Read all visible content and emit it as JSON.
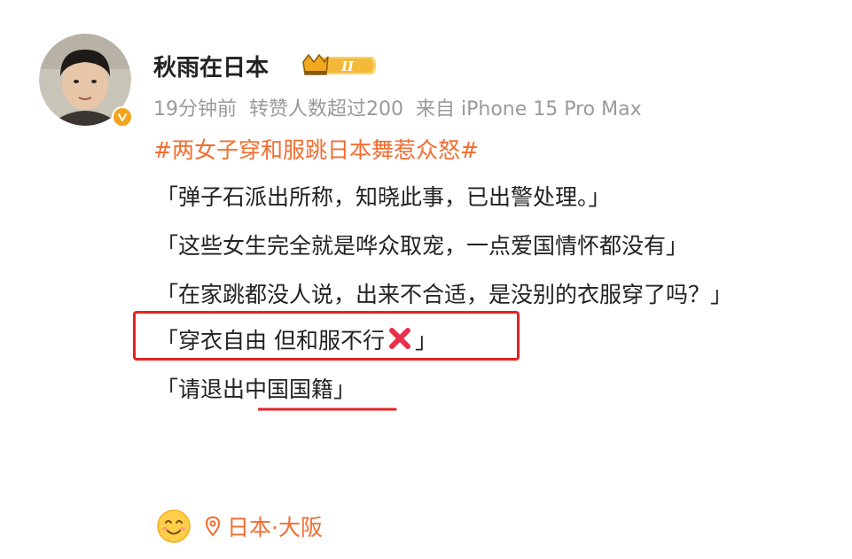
{
  "post": {
    "username": "秋雨在日本",
    "vip_level": "II",
    "meta": {
      "time": "19分钟前",
      "likes_note": "转赞人数超过200",
      "source": "来自 iPhone 15 Pro Max"
    },
    "hashtag": "#两女子穿和服跳日本舞惹众怒#",
    "comments": [
      "「弹子石派出所称，知晓此事，已出警处理。」",
      "「这些女生完全就是哗众取宠，一点爱国情怀都没有」",
      "「在家跳都没人说，出来不合适，是没别的衣服穿了吗？」"
    ],
    "highlighted_comment": {
      "before": "「穿衣自由 但和服不行",
      "after": "」"
    },
    "last_comment": "「请退出中国国籍」",
    "location": "日本·大阪"
  },
  "colors": {
    "hashtag": "#f26d2f",
    "highlight_box": "#e52222",
    "verified_badge": "#f4a41c",
    "meta_text": "#9a9a9a"
  },
  "icons": {
    "verified": "verified-v-icon",
    "vip": "crown-vip-badge",
    "cross": "red-cross-icon",
    "emoji": "smiling-face-icon",
    "location": "location-pin-icon"
  }
}
